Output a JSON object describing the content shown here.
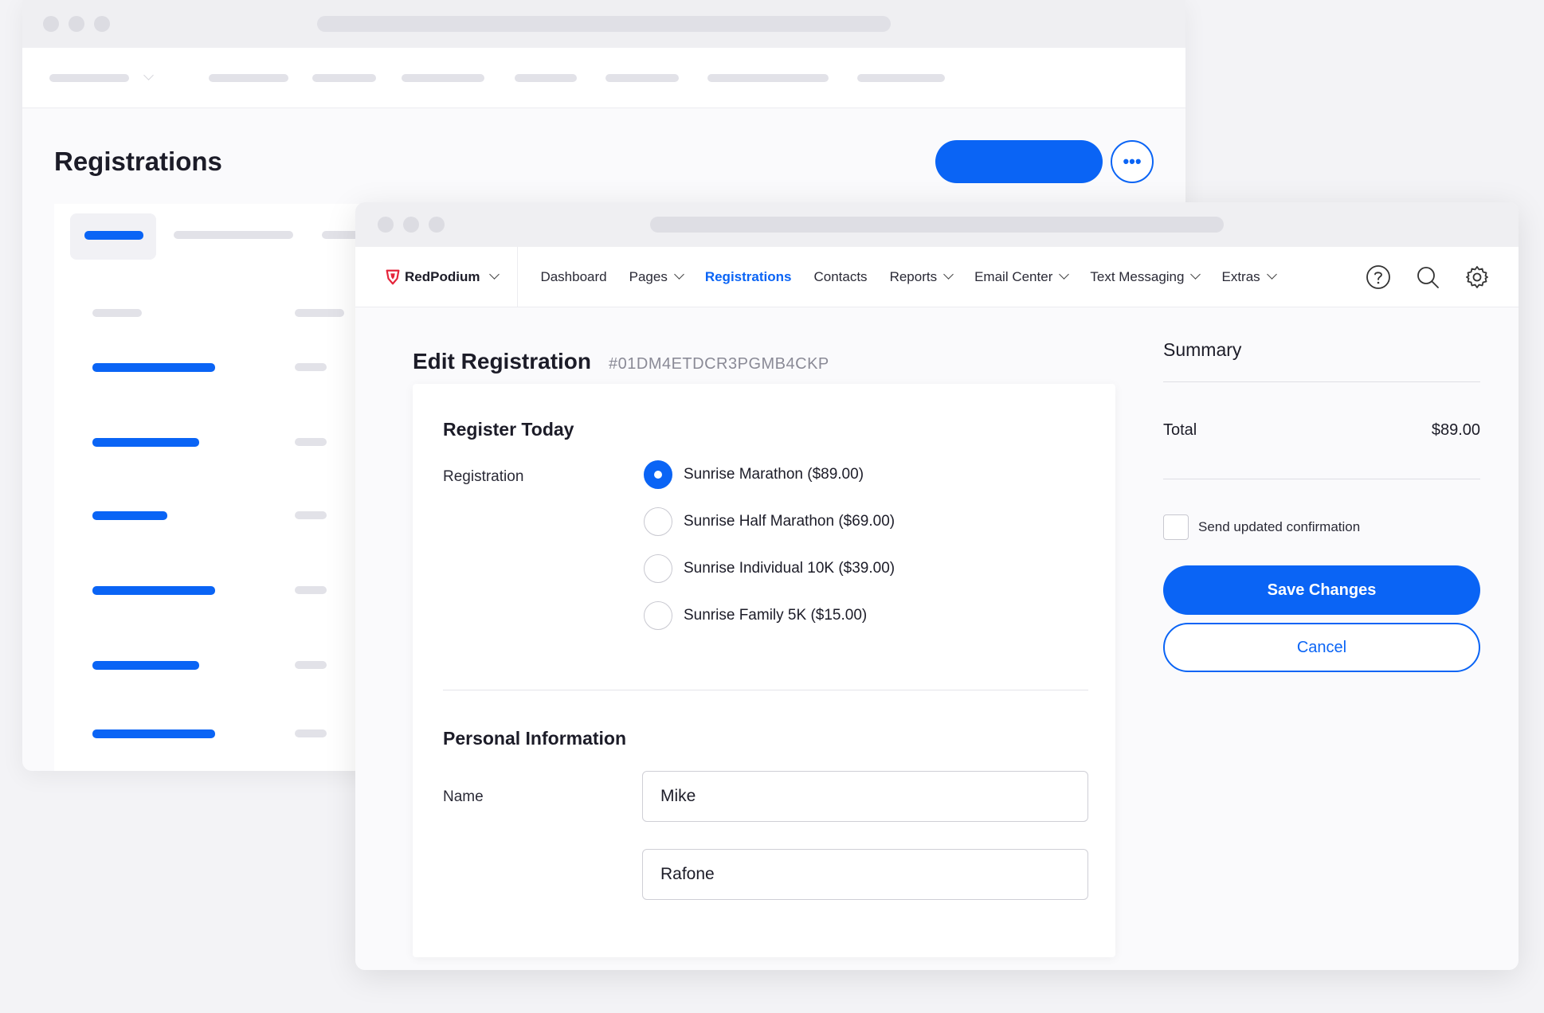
{
  "back_window": {
    "page_title": "Registrations",
    "more_button_label": "•••"
  },
  "front_window": {
    "brand": {
      "name": "RedPodium",
      "logo_icon": "redpodium-logo-icon",
      "color": "#e5253b"
    },
    "nav": {
      "items": [
        {
          "label": "Dashboard",
          "dropdown": false
        },
        {
          "label": "Pages",
          "dropdown": true
        },
        {
          "label": "Registrations",
          "dropdown": false,
          "active": true
        },
        {
          "label": "Contacts",
          "dropdown": false
        },
        {
          "label": "Reports",
          "dropdown": true
        },
        {
          "label": "Email Center",
          "dropdown": true
        },
        {
          "label": "Text Messaging",
          "dropdown": true
        },
        {
          "label": "Extras",
          "dropdown": true
        }
      ],
      "icons": [
        "help-icon",
        "search-icon",
        "gear-icon"
      ]
    },
    "edit": {
      "title": "Edit Registration",
      "id": "#01DM4ETDCR3PGMB4CKP"
    },
    "form": {
      "register_section_title": "Register Today",
      "registration_label": "Registration",
      "options": [
        {
          "label": "Sunrise Marathon ($89.00)",
          "checked": true
        },
        {
          "label": "Sunrise Half Marathon ($69.00)",
          "checked": false
        },
        {
          "label": "Sunrise Individual 10K ($39.00)",
          "checked": false
        },
        {
          "label": "Sunrise Family 5K ($15.00)",
          "checked": false
        }
      ],
      "personal_section_title": "Personal Information",
      "name_label": "Name",
      "first_name_value": "Mike",
      "last_name_value": "Rafone"
    },
    "summary": {
      "title": "Summary",
      "total_label": "Total",
      "total_value": "$89.00",
      "confirm_label": "Send updated confirmation",
      "save_label": "Save Changes",
      "cancel_label": "Cancel"
    }
  },
  "colors": {
    "accent": "#0a64f5",
    "background": "#f3f3f6"
  }
}
